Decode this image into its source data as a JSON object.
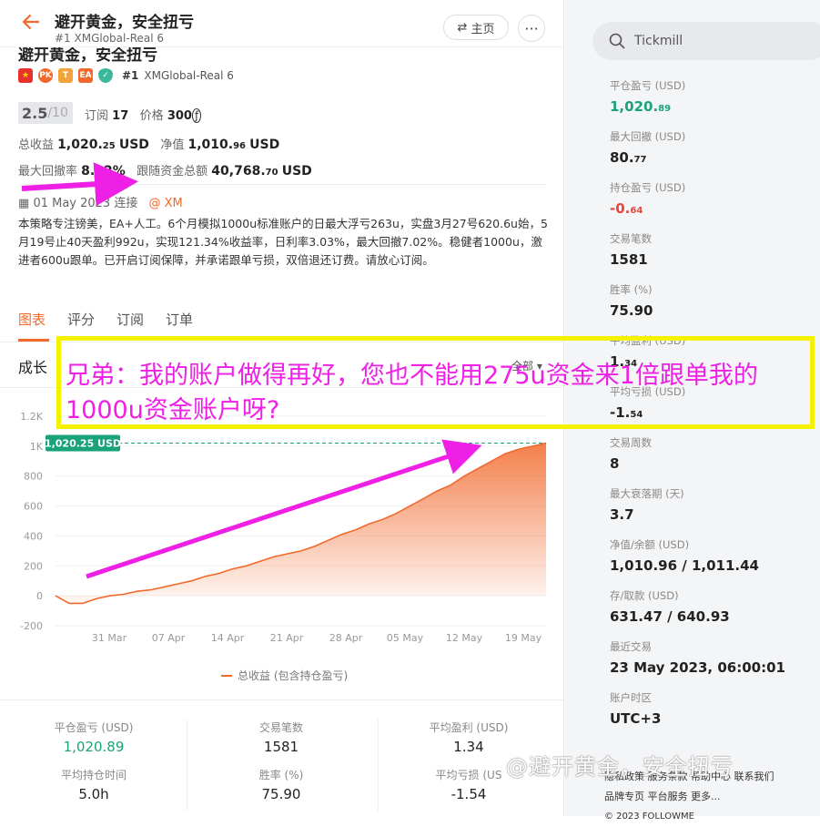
{
  "header": {
    "title": "避开黄金，安全扭亏",
    "subtitle": "#1 XMGlobal-Real 6",
    "home_label": "主页",
    "more_label": "···"
  },
  "profile": {
    "ghost_title": "避开黄金，安全扭亏",
    "flag_country": "CN",
    "badges": [
      "PK",
      "T",
      "EA",
      "✓"
    ],
    "rank": "#1",
    "account": "XMGlobal-Real 6",
    "score": "2.5",
    "score_den": "/10",
    "subs_label": "订阅",
    "subs_value": "17",
    "price_label": "价格",
    "price_value": "300",
    "total_profit_label": "总收益",
    "total_profit_main": "1,020.",
    "total_profit_dec": "25",
    "total_profit_unit": "USD",
    "equity_label": "净值",
    "equity_main": "1,010.",
    "equity_dec": "96",
    "equity_unit": "USD",
    "max_dd_label": "最大回撤率",
    "max_dd_value": "8.02%",
    "follow_label": "跟随资金总额",
    "follow_main": "40,768.",
    "follow_dec": "70",
    "follow_unit": "USD",
    "date_text": "01 May 2023 连接",
    "broker": "@ XM",
    "description": "本策略专注镑美，EA+人工。6个月模拟1000u标准账户的日最大浮亏263u，实盘3月27号620.6u始，5月19号止40天盈利992u，实现121.34%收益率，日利率3.03%，最大回撤7.02%。稳健者1000u，激进者600u跟单。已开启订阅保障，并承诺跟单亏损，双倍退还订费。请放心订阅。"
  },
  "tabs": [
    "图表",
    "评分",
    "订阅",
    "订单"
  ],
  "growth_label": "成长",
  "range_select": "全部 ▾",
  "chart_data": {
    "type": "area",
    "title": "",
    "xlabel": "",
    "ylabel": "",
    "ylim": [
      -200,
      1200
    ],
    "yticks": [
      "1.2K",
      "1K",
      "800",
      "600",
      "400",
      "200",
      "0",
      "-200"
    ],
    "xticks": [
      "31 Mar",
      "07 Apr",
      "14 Apr",
      "21 Apr",
      "28 Apr",
      "05 May",
      "12 May",
      "19 May"
    ],
    "current_label": "1,020.25 USD",
    "current_value": 1020.25,
    "series": [
      {
        "name": "总收益 (包含持仓盈亏)",
        "color": "#f2692c",
        "values": [
          0,
          -50,
          -50,
          -20,
          0,
          10,
          30,
          40,
          60,
          80,
          100,
          130,
          150,
          180,
          200,
          230,
          260,
          280,
          300,
          330,
          370,
          410,
          440,
          480,
          510,
          550,
          600,
          650,
          700,
          740,
          800,
          850,
          900,
          950,
          980,
          1000,
          1020.25
        ]
      }
    ]
  },
  "bottom_stats": [
    {
      "label": "平仓盈亏 (USD)",
      "value": "1,020.89",
      "color": "green"
    },
    {
      "label": "交易笔数",
      "value": "1581"
    },
    {
      "label": "平均盈利 (USD)",
      "value": "1.34"
    },
    {
      "label": "平均持仓时间",
      "value": "5.0h"
    },
    {
      "label": "胜率 (%)",
      "value": "75.90"
    },
    {
      "label": "平均亏损 (US",
      "value": "-1.54"
    }
  ],
  "annotation": {
    "line1": "兄弟：我的账户做得再好，您也不能用275u资金来1倍跟单我的",
    "line2": "1000u资金账户呀?"
  },
  "search": {
    "placeholder": "Tickmill"
  },
  "right_stats": [
    {
      "label": "平仓盈亏 (USD)",
      "main": "1,020.",
      "dec": "89",
      "color": "green"
    },
    {
      "label": "最大回撤 (USD)",
      "main": "80.",
      "dec": "77"
    },
    {
      "label": "持仓盈亏 (USD)",
      "main": "-0.",
      "dec": "64",
      "color": "red"
    },
    {
      "label": "交易笔数",
      "main": "1581",
      "dec": ""
    },
    {
      "label": "胜率 (%)",
      "main": "75.90",
      "dec": ""
    },
    {
      "label": "平均盈利 (USD)",
      "main": "1.",
      "dec": "34"
    },
    {
      "label": "平均亏损 (USD)",
      "main": "-1.",
      "dec": "54"
    },
    {
      "label": "交易周数",
      "main": "8",
      "dec": ""
    },
    {
      "label": "最大衰落期 (天)",
      "main": "3.7",
      "dec": ""
    },
    {
      "label": "净值/余额 (USD)",
      "main": "1,010.96 / 1,011.44",
      "dec": ""
    },
    {
      "label": "存/取款 (USD)",
      "main": "631.47 / 640.93",
      "dec": ""
    },
    {
      "label": "最近交易",
      "main": "23 May 2023, 06:00:01",
      "dec": ""
    },
    {
      "label": "账户时区",
      "main": "UTC+3",
      "dec": ""
    }
  ],
  "footer": {
    "line1": "隐私政策   服务条款   帮助中心   联系我们",
    "line2": "品牌专页   平台服务   更多...",
    "line3": "© 2023 FOLLOWME"
  },
  "watermark": "@避开黄金，安全扭亏"
}
